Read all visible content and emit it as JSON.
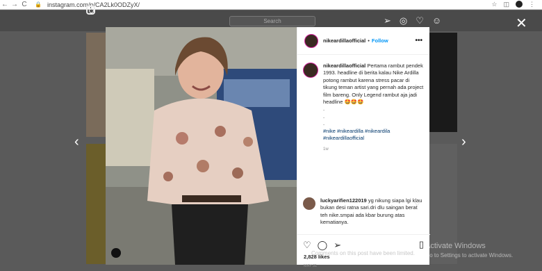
{
  "browser": {
    "url": "instagram.com/p/CA2Lk0ODZyX/",
    "back": "←",
    "forward": "→",
    "reload": "C",
    "icons": [
      "star-icon",
      "extensions-icon",
      "profile-icon",
      "menu-icon"
    ]
  },
  "header": {
    "search_placeholder": "Search",
    "icons": [
      "paper-plane-icon",
      "compass-icon",
      "heart-icon",
      "person-icon"
    ]
  },
  "post": {
    "username": "nikeardillaofficial",
    "follow": "Follow",
    "caption": "Pertama rambut pendek 1993. headline di berita kalau Nike Ardilla potong rambut karena stress pacar di tikung teman artist yang pernah ada project film bareng. Only Legend rambut aja jadi headline 🤩🤩🤩",
    "dots": [
      ".",
      ".",
      "."
    ],
    "hashtags": "#nike #nikeardilla #nikeardila #nikeardillaofficial",
    "time": "1w",
    "comment_user": "luckyarifien122019",
    "comment_text": "yg nikung siapa lgi klau bukan desi ratna sari.dri dlu saingan berat teh nike.smpai ada kbar burung atas kematianya.",
    "likes": "2,828 likes",
    "date": "MAY 31",
    "comments_disabled": "Comments on this post have been limited."
  },
  "overlay": {
    "close": "✕",
    "prev": "‹",
    "next": "›",
    "watermark_title": "Activate Windows",
    "watermark_sub": "Go to Settings to activate Windows."
  }
}
